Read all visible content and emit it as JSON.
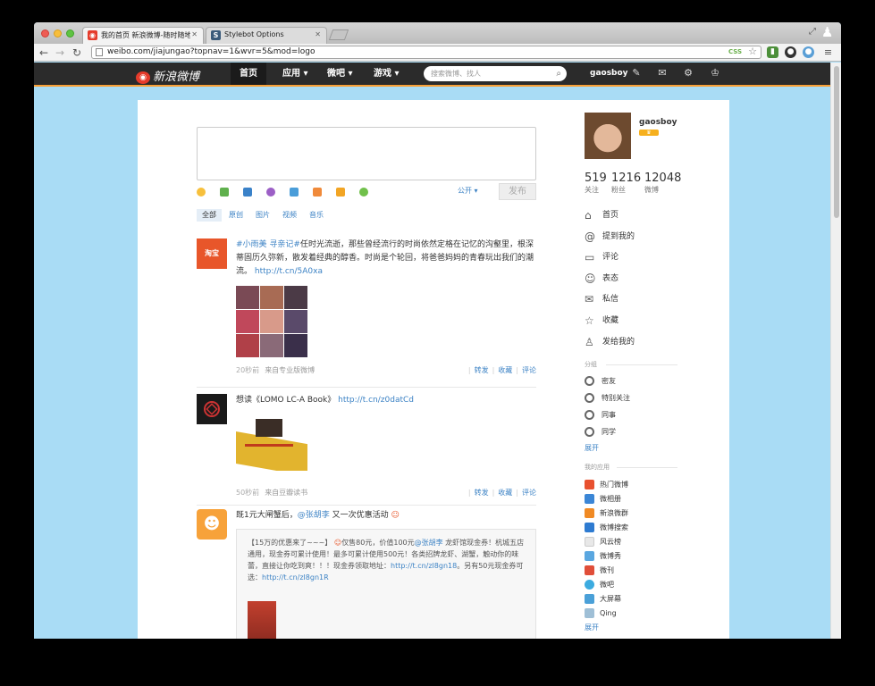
{
  "browser": {
    "tabs": [
      {
        "label": "我的首页 新浪微博-随时随地分",
        "favicon": "weibo"
      },
      {
        "label": "Stylebot Options",
        "favicon": "S"
      }
    ],
    "url": "weibo.com/jiajungao?topnav=1&wvr=5&mod=logo",
    "css_badge": "CSS"
  },
  "weibo_nav": {
    "logo": "新浪微博",
    "menu": [
      {
        "label": "首页"
      },
      {
        "label": "应用 ▾"
      },
      {
        "label": "微吧 ▾"
      },
      {
        "label": "游戏 ▾"
      }
    ],
    "search_placeholder": "搜索微博、找人",
    "username": "gaosboy"
  },
  "composer": {
    "visibility": "公开 ▾",
    "publish_label": "发布"
  },
  "filter_tabs": [
    "全部",
    "原创",
    "图片",
    "视频",
    "音乐"
  ],
  "feed": [
    {
      "topic": "#小雨美 寻亲记#",
      "text": "任时光流逝，那些曾经流行的时尚依然定格在记忆的沟壑里，根深蒂固历久弥新，散发着经典的醇香。时尚是个轮回，将爸爸妈妈的青春玩出我们的潮流。",
      "link": "http://t.cn/5A0xa",
      "time": "20秒前",
      "source": "来自专业版微博",
      "avatar_text": "淘宝"
    },
    {
      "text": "想读《LOMO LC-A Book》",
      "link": "http://t.cn/z0datCd",
      "time": "50秒前",
      "source": "来自豆瓣读书"
    },
    {
      "text_before": "既1元大闸蟹后，",
      "mention": "@张胡李",
      "text_after": " 又一次优惠活动",
      "quote": {
        "text_a": "【15万的优惠来了~~~】",
        "text_b": "仅售80元，价值100元",
        "mention": "@张胡李",
        "text_c": " 龙虾馆现金券！杭城五店通用，现金券可累计使用！最多可累计使用500元！各类招牌龙虾、湖蟹，触动你的味蕾，直接让你吃到爽！！！现金券领取地址：",
        "link1": "http://t.cn/zl8gn18",
        "text_d": "。另有50元现金券可选：",
        "link2": "http://t.cn/zl8gn1R"
      }
    }
  ],
  "actions": {
    "repost": "转发",
    "favorite": "收藏",
    "comment": "评论"
  },
  "profile": {
    "name": "gaosboy",
    "stats": [
      {
        "num": "519",
        "label": "关注"
      },
      {
        "num": "1216",
        "label": "粉丝"
      },
      {
        "num": "12048",
        "label": "微博"
      }
    ]
  },
  "side_nav": [
    {
      "label": "首页",
      "icon": "home-icon"
    },
    {
      "label": "提到我的",
      "icon": "at-icon"
    },
    {
      "label": "评论",
      "icon": "comment-icon"
    },
    {
      "label": "表态",
      "icon": "smile-icon"
    },
    {
      "label": "私信",
      "icon": "mail-icon"
    },
    {
      "label": "收藏",
      "icon": "star-icon"
    },
    {
      "label": "发给我的",
      "icon": "user-icon"
    }
  ],
  "groups": {
    "heading": "分组",
    "items": [
      "密友",
      "特别关注",
      "同事",
      "同学"
    ],
    "expand": "展开"
  },
  "apps": {
    "heading": "我的应用",
    "items": [
      {
        "label": "热门微博",
        "color": "#e8512f"
      },
      {
        "label": "微相册",
        "color": "#3b86d6"
      },
      {
        "label": "新浪微群",
        "color": "#f08a24"
      },
      {
        "label": "微博搜索",
        "color": "#2e7bd1"
      },
      {
        "label": "风云榜",
        "color": "#e8e8e8"
      },
      {
        "label": "微博秀",
        "color": "#5aa7e0"
      },
      {
        "label": "微刊",
        "color": "#e04e39"
      },
      {
        "label": "微吧",
        "color": "#3cabe0"
      },
      {
        "label": "大屏幕",
        "color": "#4aa0d8"
      },
      {
        "label": "Qing",
        "color": "#9fbfd6"
      }
    ],
    "expand": "展开"
  },
  "colors": {
    "accent_link": "#3d83c5",
    "page_background": "#a9dcf5",
    "nav_background": "#2b2b2b"
  }
}
